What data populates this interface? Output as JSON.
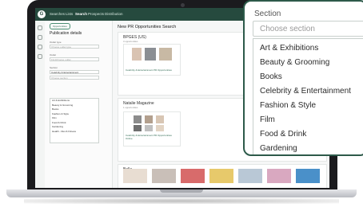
{
  "app": {
    "logo_text": "G",
    "nav": [
      "Searches",
      "Lists",
      "Search",
      "Prospects",
      "Distribution"
    ],
    "active_nav": "Search"
  },
  "sidebar": {
    "chip": "Opportunities",
    "title": "Publication details",
    "fields": [
      {
        "label": "Outlet type",
        "placeholder": "Choose outlet type"
      },
      {
        "label": "Outlet",
        "placeholder": "Find/choose outlet"
      },
      {
        "label": "Section",
        "value": "Celebrity & Entertainment"
      }
    ],
    "section_placeholder": "Choose section",
    "section_options": [
      "Art & Exhibitions",
      "Beauty & Grooming",
      "Books",
      "Fashion & Style",
      "Film",
      "Food & Drink",
      "Gardening",
      "Health - Diet & Fitness"
    ]
  },
  "main": {
    "title": "New PR Opportunities Search",
    "results": [
      {
        "title": "BPGES (US)",
        "count": "3 opportunities",
        "caption": "Celebrity & Entertainment PR Opportunities"
      },
      {
        "title": "Natalie Magazine",
        "count": "1 opportunities",
        "caption": "Celebrity & Entertainment PR Opportunities Online"
      },
      {
        "title": "Bella",
        "count": "8 opportunities"
      }
    ]
  },
  "callout": {
    "label": "Section",
    "placeholder": "Choose section",
    "options": [
      "Art & Exhibitions",
      "Beauty & Grooming",
      "Books",
      "Celebrity & Entertainment",
      "Fashion & Style",
      "Film",
      "Food & Drink",
      "Gardening"
    ]
  },
  "colors": {
    "brand": "#264a3e",
    "accent": "#2d5a4a",
    "link": "#2f6a52"
  },
  "icons": [
    "chevron-up-icon",
    "filter-icon",
    "search-icon",
    "settings-icon"
  ]
}
